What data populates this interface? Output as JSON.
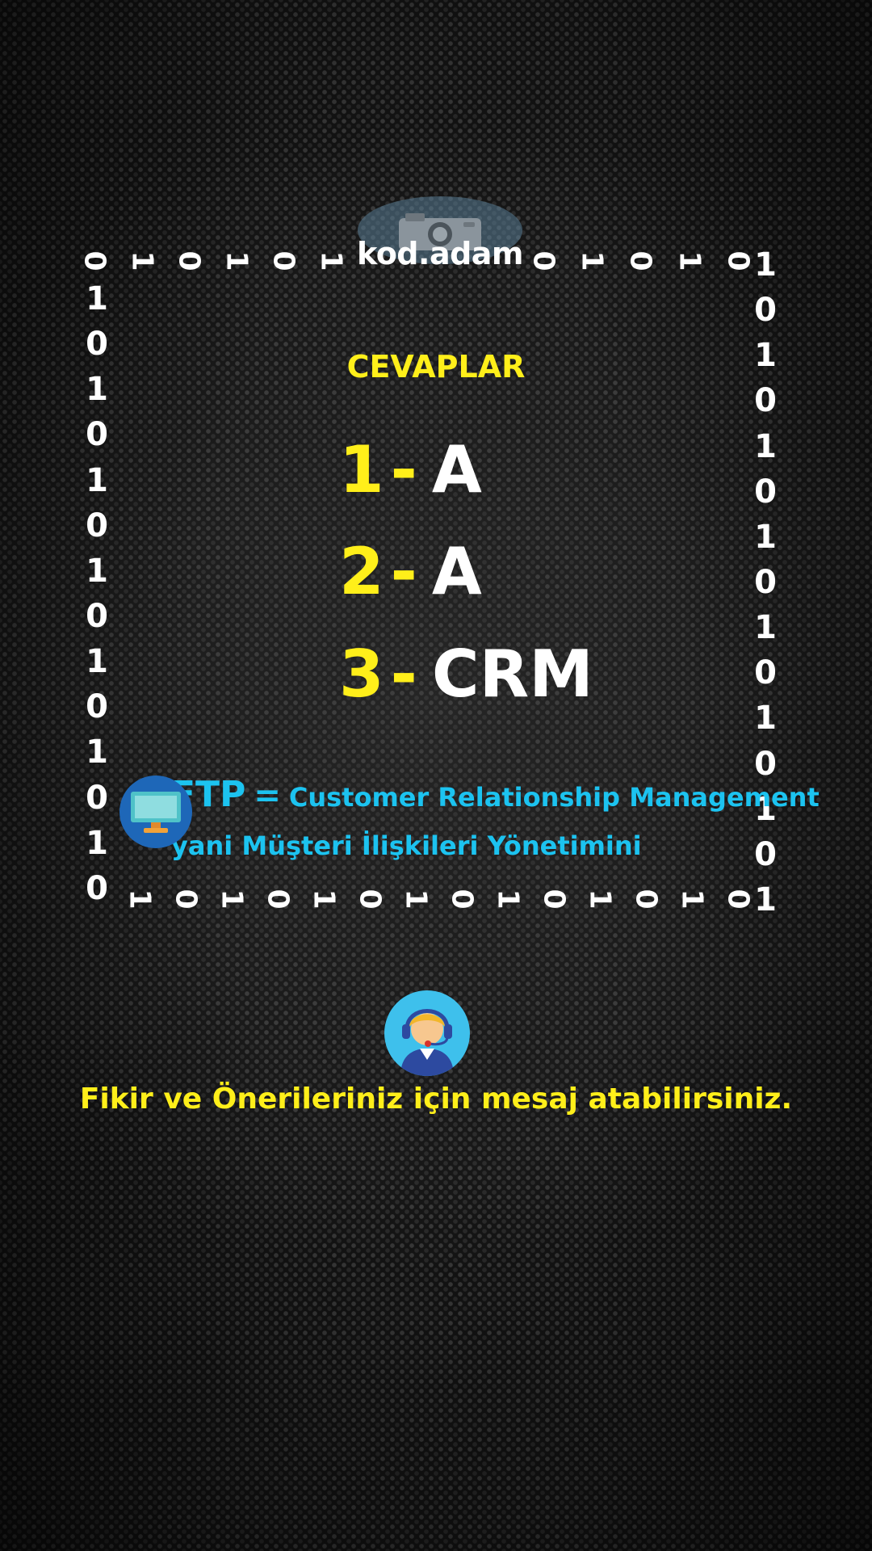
{
  "brand": "kod.adam",
  "heading": "CEVAPLAR",
  "answers": [
    {
      "num": "1",
      "dash": "-",
      "answer": "A"
    },
    {
      "num": "2",
      "dash": "-",
      "answer": "A"
    },
    {
      "num": "3",
      "dash": "-",
      "answer": "CRM"
    }
  ],
  "definition": {
    "abbr": "FTP",
    "eq": "=",
    "full": "Customer Relationship Management",
    "description": "yani Müşteri İlişkileri Yönetimini"
  },
  "footer": "Fikir ve Önerileriniz için mesaj atabilirsiniz.",
  "binary": {
    "top_left": [
      "0",
      "1",
      "0",
      "1",
      "0",
      "1"
    ],
    "top_right": [
      "0",
      "1",
      "0",
      "1",
      "0"
    ],
    "left": [
      "1",
      "0",
      "1",
      "0",
      "1",
      "0",
      "1",
      "0",
      "1",
      "0",
      "1",
      "0",
      "1",
      "0"
    ],
    "right": [
      "1",
      "0",
      "1",
      "0",
      "1",
      "0",
      "1",
      "0",
      "1",
      "0",
      "1",
      "0",
      "1",
      "0",
      "1"
    ],
    "bottom": [
      "1",
      "0",
      "1",
      "0",
      "1",
      "0",
      "1",
      "0",
      "1",
      "0",
      "1",
      "0",
      "1",
      "0"
    ]
  },
  "colors": {
    "accent_yellow": "#ffef1a",
    "accent_cyan": "#1cc3f0",
    "text_white": "#ffffff"
  },
  "icons": {
    "brand": "camera-icon",
    "definition": "monitor-icon",
    "footer": "support-agent-icon"
  }
}
